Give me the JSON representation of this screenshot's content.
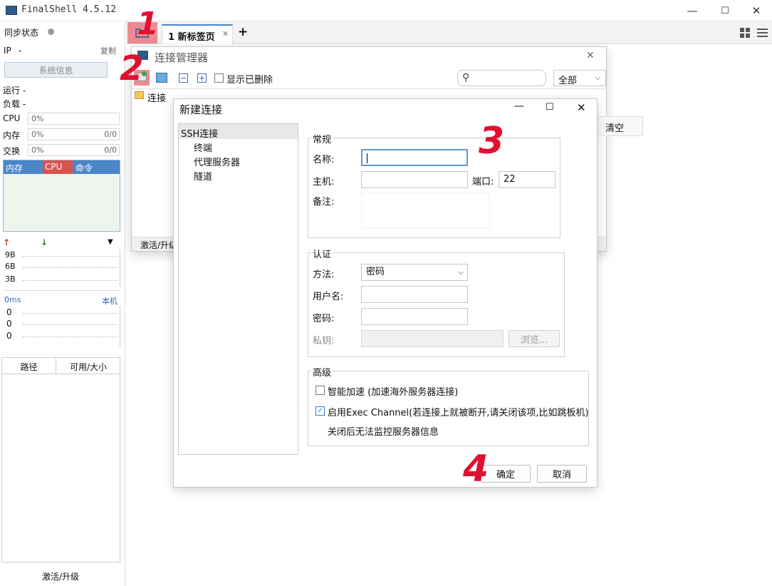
{
  "app": {
    "title": "FinalShell 4.5.12"
  },
  "window_controls": {
    "minimize": "—",
    "maximize": "☐",
    "close": "✕"
  },
  "left": {
    "sync_label": "同步状态",
    "ip_label": "IP",
    "ip_value": "-",
    "copy": "复制",
    "sysinfo_button": "系统信息",
    "uptime_label": "运行 -",
    "load_label": "负载 -",
    "cpu_label": "CPU",
    "cpu_value": "0%",
    "mem_label": "内存",
    "mem_value": "0%",
    "mem_ratio": "0/0",
    "swap_label": "交换",
    "swap_value": "0%",
    "swap_ratio": "0/0",
    "proc_headers": [
      "内存",
      "CPU",
      "命令"
    ],
    "net_ticks": [
      "9B",
      "6B",
      "3B"
    ],
    "ping_label": "0ms",
    "ping_target": "本机",
    "ping_ticks": [
      "0",
      "0",
      "0"
    ],
    "disk_headers": [
      "路径",
      "可用/大小"
    ],
    "activate": "激活/升级"
  },
  "tabs": {
    "active": "1 新标签页",
    "add": "+"
  },
  "conn_manager": {
    "title": "连接管理器",
    "show_deleted": "显示已删除",
    "filter_value": "全部",
    "tree_root": "连接",
    "clear_partial": "清空",
    "activate_partial": "激活/升级"
  },
  "new_conn": {
    "title": "新建连接",
    "tree": [
      "SSH连接",
      "终端",
      "代理服务器",
      "隧道"
    ],
    "general_legend": "常规",
    "name_label": "名称:",
    "name_value": "",
    "host_label": "主机:",
    "host_value": "",
    "port_label": "端口:",
    "port_value": "22",
    "remark_label": "备注:",
    "auth_legend": "认证",
    "method_label": "方法:",
    "method_value": "密码",
    "user_label": "用户名:",
    "password_label": "密码:",
    "key_label": "私钥:",
    "browse": "浏览...",
    "adv_legend": "高级",
    "accel_label": "智能加速 (加速海外服务器连接)",
    "accel_checked": false,
    "exec_label": "启用Exec Channel(若连接上就被断开,请关闭该项,比如跳板机)",
    "exec_checked": true,
    "exec_note": "关闭后无法监控服务器信息",
    "ok": "确定",
    "cancel": "取消"
  },
  "annotations": [
    "1",
    "2",
    "3",
    "4"
  ],
  "colors": {
    "accent": "#4a86c8",
    "cpu_header": "#d9534f",
    "annotation": "#e01030",
    "highlight": "#f0808a"
  }
}
